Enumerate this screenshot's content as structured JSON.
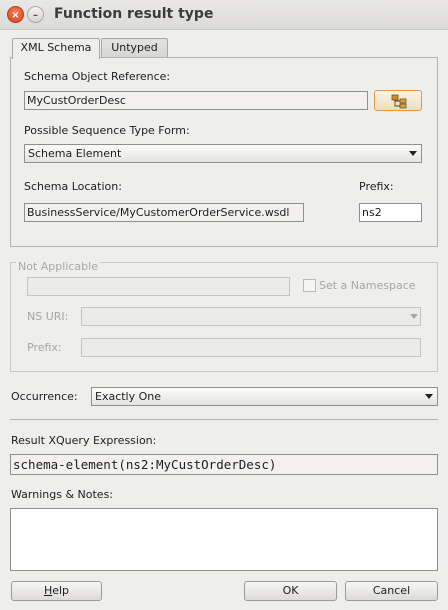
{
  "window": {
    "title": "Function result type",
    "close_glyph": "×",
    "minimize_glyph": "–"
  },
  "tabs": [
    {
      "label": "XML Schema",
      "active": true
    },
    {
      "label": "Untyped",
      "active": false
    }
  ],
  "schema": {
    "object_reference_label": "Schema Object Reference:",
    "object_reference_value": "MyCustOrderDesc",
    "sequence_type_label": "Possible Sequence Type Form:",
    "sequence_type_value": "Schema Element",
    "location_label": "Schema Location:",
    "location_value": "BusinessService/MyCustomerOrderService.wsdl",
    "prefix_label": "Prefix:",
    "prefix_value": "ns2"
  },
  "not_applicable": {
    "legend": "Not Applicable",
    "set_namespace_label": "Set a Namespace",
    "ns_uri_label": "NS URI:",
    "prefix_label": "Prefix:"
  },
  "occurrence": {
    "label": "Occurrence:",
    "value": "Exactly One"
  },
  "result": {
    "label": "Result XQuery Expression:",
    "value": "schema-element(ns2:MyCustOrderDesc)"
  },
  "warnings": {
    "label": "Warnings & Notes:"
  },
  "buttons": {
    "help_mnemonic": "H",
    "help_rest": "elp",
    "ok": "OK",
    "cancel": "Cancel"
  },
  "colors": {
    "accent_border": "#e29a3b",
    "close_button": "#d4451d"
  }
}
